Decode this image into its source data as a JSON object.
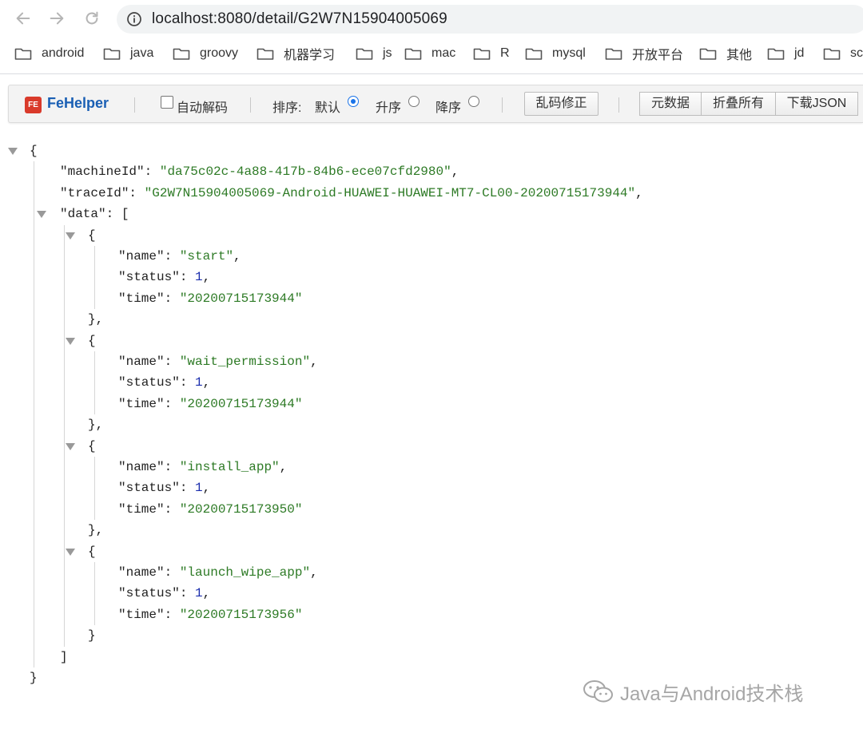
{
  "browser": {
    "url": "localhost:8080/detail/G2W7N15904005069",
    "bookmarks": [
      "android",
      "java",
      "groovy",
      "机器学习",
      "js",
      "mac",
      "R",
      "mysql",
      "开放平台",
      "其他",
      "jd",
      "sc"
    ]
  },
  "fehelper": {
    "title": "FeHelper",
    "logo_text": "FE",
    "auto_decode_label": "自动解码",
    "sort_label": "排序:",
    "sort_options": [
      "默认",
      "升序",
      "降序"
    ],
    "sort_selected": "默认",
    "fix_button": "乱码修正",
    "meta_button": "元数据",
    "collapse_button": "折叠所有",
    "download_button": "下载JSON"
  },
  "json": {
    "machineId": "da75c02c-4a88-417b-84b6-ece07cfd2980",
    "traceId": "G2W7N15904005069-Android-HUAWEI-HUAWEI-MT7-CL00-20200715173944",
    "data": [
      {
        "name": "start",
        "status": "1",
        "time": "20200715173944"
      },
      {
        "name": "wait_permission",
        "status": "1",
        "time": "20200715173944"
      },
      {
        "name": "install_app",
        "status": "1",
        "time": "20200715173950"
      },
      {
        "name": "launch_wipe_app",
        "status": "1",
        "time": "20200715173956"
      }
    ]
  },
  "watermark": {
    "text": "Java与Android技术栈"
  }
}
